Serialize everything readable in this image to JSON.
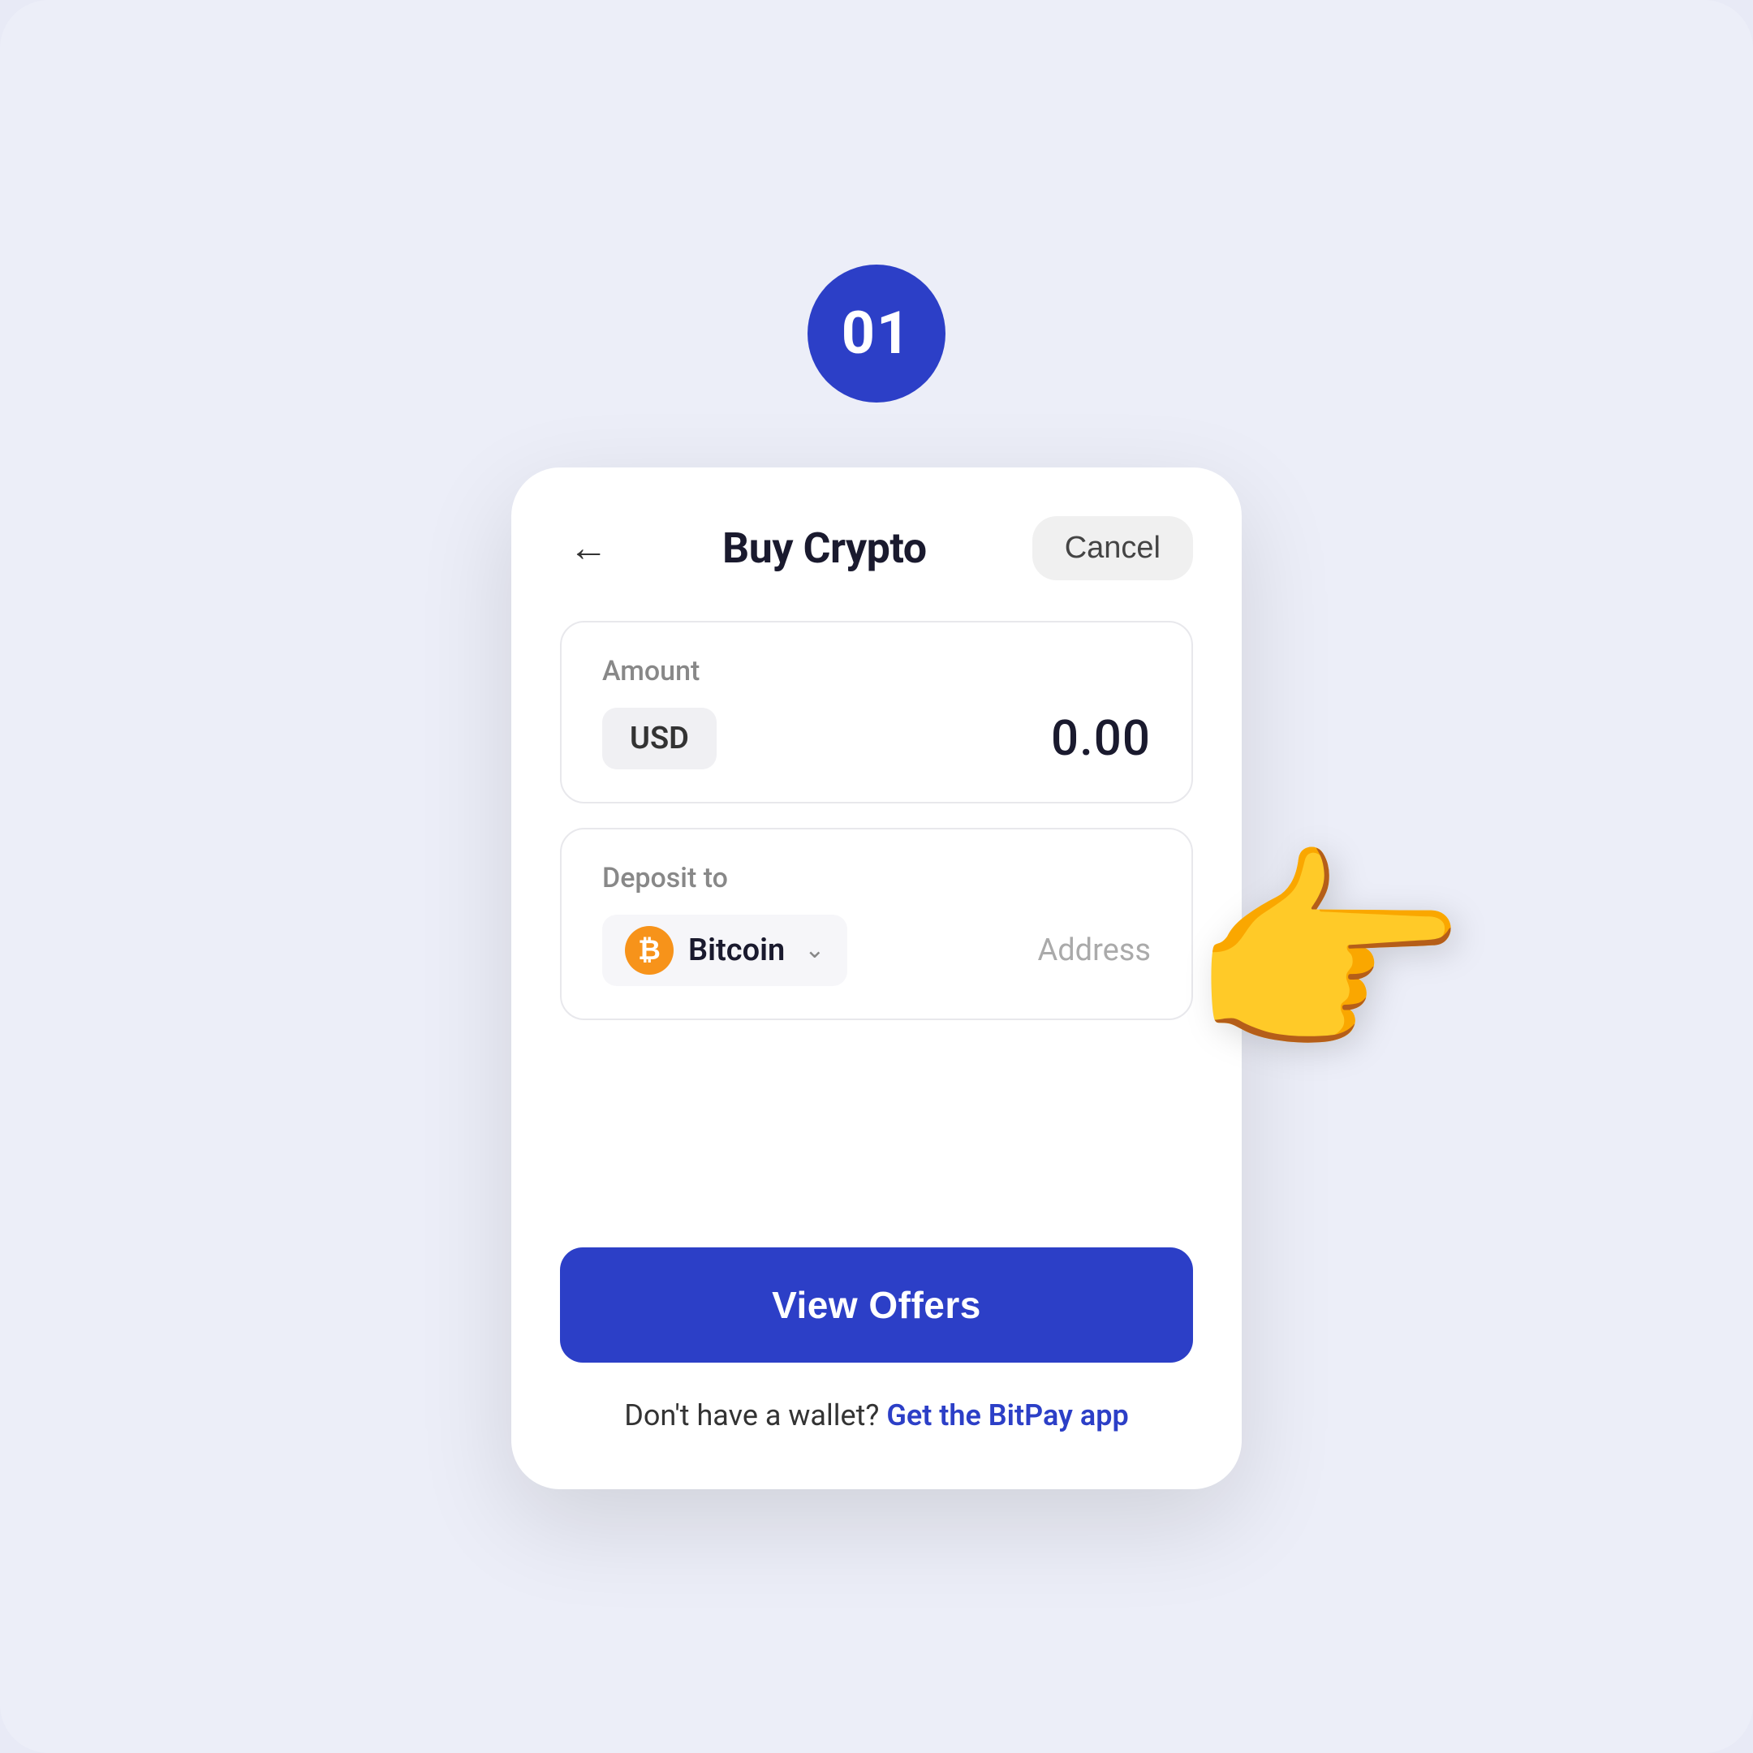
{
  "step": {
    "number": "01"
  },
  "header": {
    "back_icon": "←",
    "title": "Buy Crypto",
    "cancel_label": "Cancel"
  },
  "amount_section": {
    "label": "Amount",
    "currency": "USD",
    "value": "0.00"
  },
  "deposit_section": {
    "label": "Deposit to",
    "coin_name": "Bitcoin",
    "coin_symbol": "₿",
    "address_placeholder": "Address"
  },
  "cta": {
    "button_label": "View Offers"
  },
  "footer": {
    "static_text": "Don't have a wallet?",
    "link_text": "Get the BitPay app"
  },
  "colors": {
    "primary": "#2c3fc7",
    "background": "#eceef8",
    "card_border": "#e8e8ec",
    "bitcoin_orange": "#f7931a",
    "text_dark": "#1a1a2e",
    "text_muted": "#888888",
    "text_light": "#aaaaaa"
  }
}
